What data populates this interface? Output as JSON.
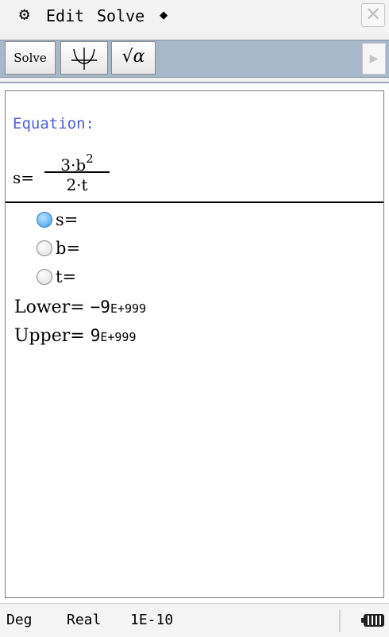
{
  "menubar": {
    "settings_icon": "gear-icon",
    "edit_label": "Edit",
    "solve_label": "Solve",
    "extra_symbol": "◆",
    "close_symbol": "✕"
  },
  "toolbar": {
    "solve_label": "Solve",
    "graph_icon": "graph-icon",
    "sqrt_label": "√α",
    "next_symbol": "▶"
  },
  "equation": {
    "label": "Equation:",
    "lhs": "s=",
    "numerator_base": "3·b",
    "numerator_exp": "2",
    "denominator": "2·t"
  },
  "variables": [
    {
      "label": "s=",
      "selected": true
    },
    {
      "label": "b=",
      "selected": false
    },
    {
      "label": "t=",
      "selected": false
    }
  ],
  "bounds": {
    "lower_label": "Lower=",
    "lower_mantissa": "−9",
    "lower_exp": "E+999",
    "upper_label": "Upper=",
    "upper_mantissa": "9",
    "upper_exp": "E+999"
  },
  "status": {
    "angle": "Deg",
    "mode": "Real",
    "tolerance": "1E-10",
    "battery_icon": "battery-icon"
  },
  "colors": {
    "equation_label": "#4a5fe0",
    "toolbar_strip": "#a6b8c9",
    "radio_selected": "#3f9ee6"
  }
}
